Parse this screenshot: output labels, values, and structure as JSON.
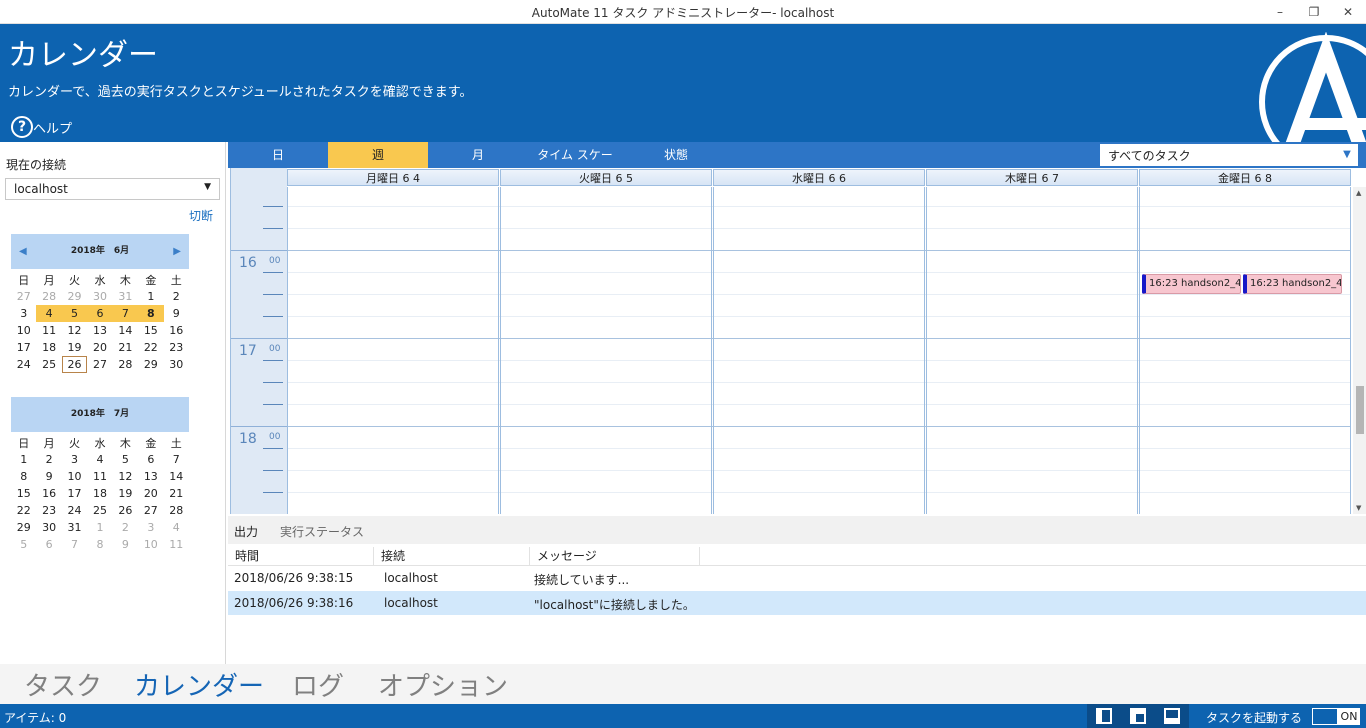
{
  "window": {
    "title": "AutoMate 11 タスク アドミニストレーター- localhost",
    "minimize": "–",
    "restore": "❐",
    "close": "✕"
  },
  "header": {
    "title": "カレンダー",
    "subtitle": "カレンダーで、過去の実行タスクとスケジュールされたタスクを確認できます。",
    "help_icon": "?",
    "help_label": "ヘルプ"
  },
  "sidebar": {
    "connection_label": "現在の接続",
    "connection_value": "localhost",
    "disconnect": "切断",
    "june": {
      "title": "2018年　6月",
      "weekdays": [
        "日",
        "月",
        "火",
        "水",
        "木",
        "金",
        "土"
      ],
      "weeks": [
        [
          "27",
          "28",
          "29",
          "30",
          "31",
          "1",
          "2"
        ],
        [
          "3",
          "4",
          "5",
          "6",
          "7",
          "8",
          "9"
        ],
        [
          "10",
          "11",
          "12",
          "13",
          "14",
          "15",
          "16"
        ],
        [
          "17",
          "18",
          "19",
          "20",
          "21",
          "22",
          "23"
        ],
        [
          "24",
          "25",
          "26",
          "27",
          "28",
          "29",
          "30"
        ]
      ]
    },
    "july": {
      "title": "2018年　7月",
      "weekdays": [
        "日",
        "月",
        "火",
        "水",
        "木",
        "金",
        "土"
      ],
      "weeks": [
        [
          "1",
          "2",
          "3",
          "4",
          "5",
          "6",
          "7"
        ],
        [
          "8",
          "9",
          "10",
          "11",
          "12",
          "13",
          "14"
        ],
        [
          "15",
          "16",
          "17",
          "18",
          "19",
          "20",
          "21"
        ],
        [
          "22",
          "23",
          "24",
          "25",
          "26",
          "27",
          "28"
        ],
        [
          "29",
          "30",
          "31",
          "1",
          "2",
          "3",
          "4"
        ],
        [
          "5",
          "6",
          "7",
          "8",
          "9",
          "10",
          "11"
        ]
      ]
    }
  },
  "views": {
    "tabs": [
      "日",
      "週",
      "月",
      "タイム スケー",
      "状態"
    ],
    "active": "週",
    "filter": "すべてのタスク",
    "filter_arrow": "▼"
  },
  "calendar": {
    "days": [
      "月曜日 6 4",
      "火曜日 6 5",
      "水曜日 6 6",
      "木曜日 6 7",
      "金曜日 6 8"
    ],
    "hours": [
      "16",
      "17",
      "18"
    ],
    "minutes": "00",
    "appointments": [
      "16:23 handson2_4",
      "16:23 handson2_4"
    ]
  },
  "output": {
    "tabs": [
      "出力",
      "実行ステータス"
    ],
    "columns": [
      "時間",
      "接続",
      "メッセージ"
    ],
    "rows": [
      {
        "time": "2018/06/26 9:38:15",
        "conn": "localhost",
        "msg": "接続しています..."
      },
      {
        "time": "2018/06/26 9:38:16",
        "conn": "localhost",
        "msg": "\"localhost\"に接続しました。"
      }
    ]
  },
  "nav": {
    "items": [
      "タスク",
      "カレンダー",
      "ログ",
      "オプション"
    ],
    "active": "カレンダー"
  },
  "status": {
    "items": "アイテム: 0",
    "start_task": "タスクを起動する",
    "toggle": "ON"
  },
  "colors": {
    "brand": "#0d63b0",
    "highlight": "#f9c84f",
    "appointment": "#f7c6cf"
  }
}
